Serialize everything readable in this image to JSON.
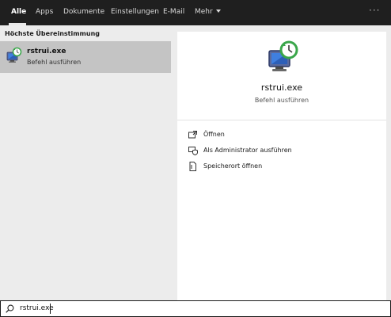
{
  "tabs": [
    {
      "label": "Alle"
    },
    {
      "label": "Apps"
    },
    {
      "label": "Dokumente"
    },
    {
      "label": "Einstellungen"
    },
    {
      "label": "E-Mail"
    }
  ],
  "more_tab": "Mehr",
  "overflow": "···",
  "results": {
    "section_header": "Höchste Übereinstimmung",
    "item": {
      "title": "rstrui.exe",
      "subtitle": "Befehl ausführen",
      "icon": "system-restore-icon"
    }
  },
  "detail": {
    "title": "rstrui.exe",
    "subtitle": "Befehl ausführen",
    "icon": "system-restore-icon",
    "actions": [
      {
        "label": "Öffnen",
        "icon": "open-icon"
      },
      {
        "label": "Als Administrator ausführen",
        "icon": "admin-shield-icon"
      },
      {
        "label": "Speicherort öffnen",
        "icon": "file-location-icon"
      }
    ]
  },
  "search": {
    "value": "rstrui.exe",
    "icon": "search-icon"
  },
  "colors": {
    "topbar": "#1f1f1f",
    "selected": "#c4c4c4",
    "panel": "#ececec"
  }
}
